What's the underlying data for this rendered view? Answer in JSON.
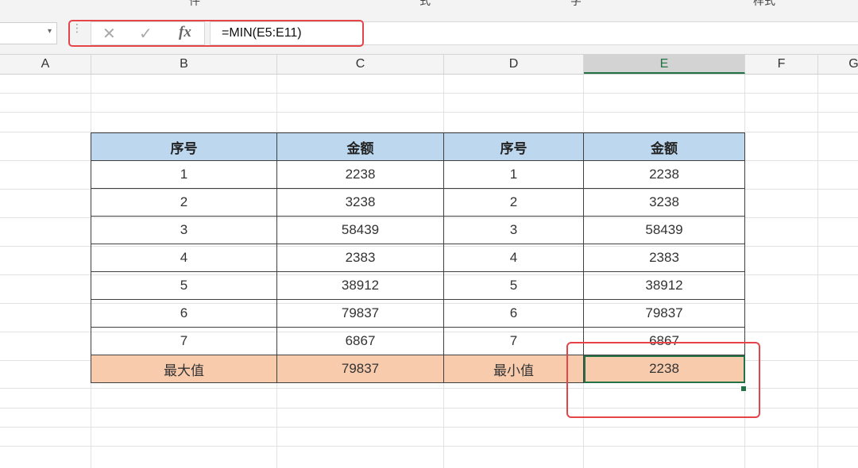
{
  "ribbon": {
    "fragments": [
      "件",
      "式",
      "字",
      "样式"
    ]
  },
  "formula_bar": {
    "name_box": "",
    "cancel_icon": "close-icon",
    "enter_icon": "check-icon",
    "fx_label": "fx",
    "formula": "=MIN(E5:E11)"
  },
  "columns": [
    "A",
    "B",
    "C",
    "D",
    "E",
    "F",
    "G"
  ],
  "selected_column": "E",
  "table": {
    "headers": [
      "序号",
      "金额",
      "序号",
      "金额"
    ],
    "rows": [
      [
        "1",
        "2238",
        "1",
        "2238"
      ],
      [
        "2",
        "3238",
        "2",
        "3238"
      ],
      [
        "3",
        "58439",
        "3",
        "58439"
      ],
      [
        "4",
        "2383",
        "4",
        "2383"
      ],
      [
        "5",
        "38912",
        "5",
        "38912"
      ],
      [
        "6",
        "79837",
        "6",
        "79837"
      ],
      [
        "7",
        "6867",
        "7",
        "6867"
      ]
    ],
    "footer": [
      "最大值",
      "79837",
      "最小值",
      "2238"
    ]
  },
  "colors": {
    "header_fill": "#bdd7ee",
    "footer_fill": "#f8cbad",
    "selection": "#217346",
    "highlight_box": "#e5444b"
  }
}
